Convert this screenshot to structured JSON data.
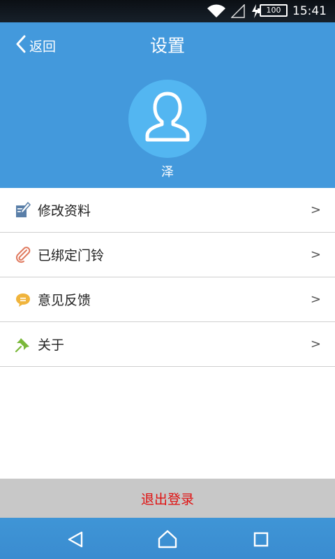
{
  "status_bar": {
    "time": "15:41",
    "battery": "100"
  },
  "header": {
    "back_label": "返回",
    "title": "设置",
    "username": "泽",
    "background_color": "#4399dc",
    "avatar_color": "#53b6f1"
  },
  "menu": {
    "items": [
      {
        "label": "修改资料",
        "icon": "edit-icon",
        "arrow": ">"
      },
      {
        "label": "已绑定门铃",
        "icon": "paperclip-icon",
        "arrow": ">"
      },
      {
        "label": "意见反馈",
        "icon": "chat-bubble-icon",
        "arrow": ">"
      },
      {
        "label": "关于",
        "icon": "pin-icon",
        "arrow": ">"
      }
    ]
  },
  "logout": {
    "label": "退出登录",
    "text_color": "#e01010"
  },
  "nav_bar": {
    "buttons": [
      "back-icon",
      "home-icon",
      "recent-apps-icon"
    ]
  }
}
